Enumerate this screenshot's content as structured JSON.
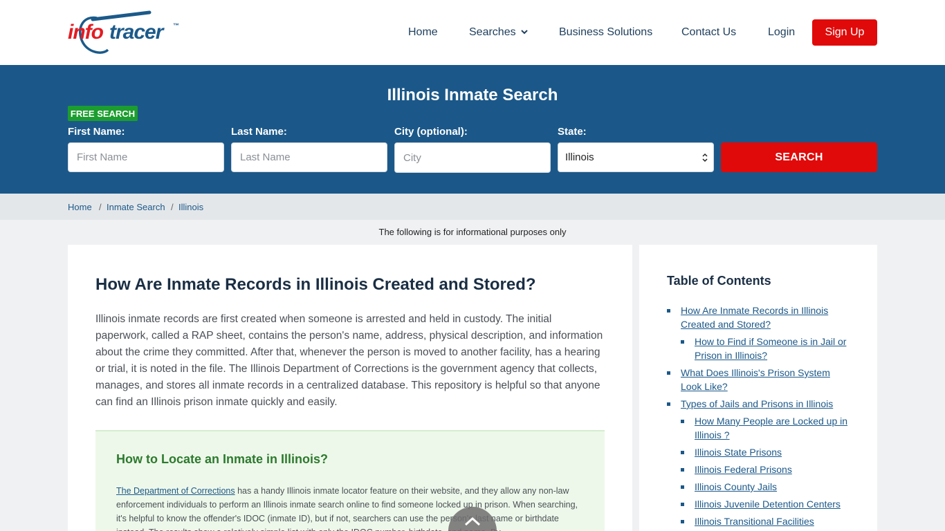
{
  "brand": {
    "info": "info",
    "tracer": "tracer",
    "tm": "™"
  },
  "nav": {
    "home": "Home",
    "searches": "Searches",
    "business": "Business Solutions",
    "contact": "Contact Us",
    "login": "Login",
    "signup": "Sign Up"
  },
  "search": {
    "title": "Illinois Inmate Search",
    "badge": "FREE SEARCH",
    "first_label": "First Name:",
    "first_placeholder": "First Name",
    "last_label": "Last Name:",
    "last_placeholder": "Last Name",
    "city_label": "City (optional):",
    "city_placeholder": "City",
    "state_label": "State:",
    "state_value": "Illinois",
    "button": "SEARCH"
  },
  "breadcrumb": {
    "items": [
      "Home",
      "Inmate Search",
      "Illinois"
    ],
    "sep": "/"
  },
  "notice": "The following is for informational purposes only",
  "main": {
    "title": "How Are Inmate Records in Illinois Created and Stored?",
    "paragraph": "Illinois inmate records are first created when someone is arrested and held in custody. The initial paperwork, called a RAP sheet, contains the person's name, address, physical description, and information about the crime they committed. After that, whenever the person is moved to another facility, has a hearing or trial, it is noted in the file. The Illinois Department of Corrections is the government agency that collects, manages, and stores all inmate records in a centralized database. This repository is helpful so that anyone can find an Illinois prison inmate quickly and easily.",
    "callout_title": "How to Locate an Inmate in Illinois?",
    "callout_link": "The Department of Corrections",
    "callout_text": " has a handy Illinois inmate locator feature on their website, and they allow any non-law enforcement individuals to perform an Illinois inmate search online to find someone locked up in prison. When searching, it's helpful to know the offender's IDOC (inmate ID), but if not, searchers can use the person's last name or birthdate instead. The results show a relatively simple list with only the IDOC number, birthdate, and name. By"
  },
  "toc": {
    "title": "Table of Contents",
    "items": [
      "How Are Inmate Records in Illinois Created and Stored?",
      "How to Find if Someone is in Jail or Prison in Illinois?",
      "What Does Illinois's Prison System Look Like?",
      "Types of Jails and Prisons in Illinois",
      "How Many People are Locked up in Illinois ?",
      "Illinois State Prisons",
      "Illinois Federal Prisons",
      "Illinois County Jails",
      "Illinois Juvenile Detention Centers",
      "Illinois Transitional Facilities"
    ]
  },
  "colors": {
    "accent_red": "#e10a0a",
    "band_blue": "#1b5889",
    "badge_green": "#1c9d2f"
  },
  "icons": {
    "searches_chevron": "chevron-down-icon",
    "scroll_top": "chevron-up-icon"
  }
}
